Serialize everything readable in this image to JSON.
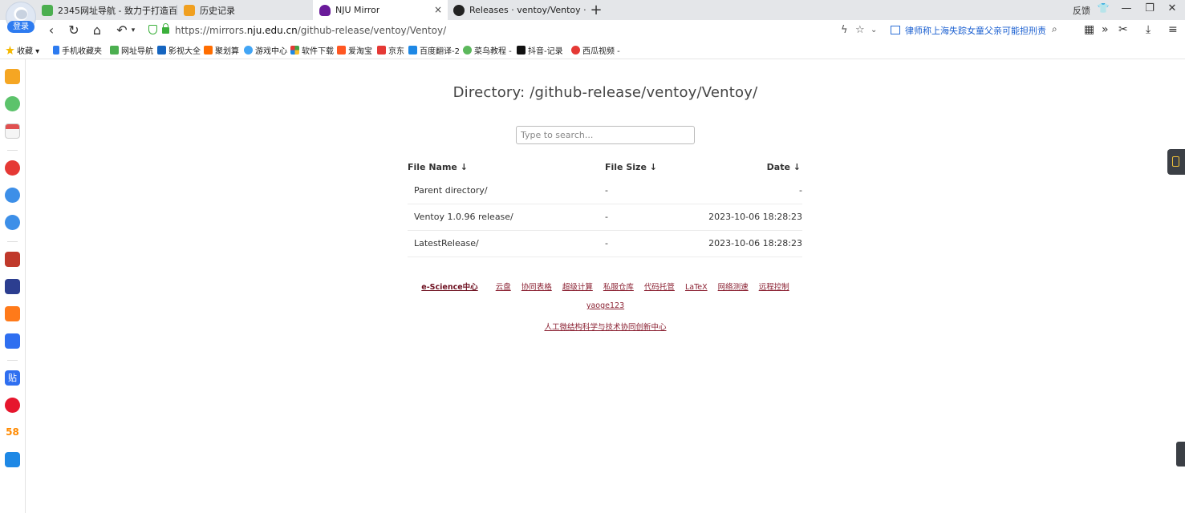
{
  "browser": {
    "login_label": "登录",
    "tabs": [
      {
        "title": "2345网址导航 - 致力于打造百",
        "color": "#4caf50"
      },
      {
        "title": "历史记录",
        "color": "#f0a020"
      },
      {
        "title": "NJU Mirror",
        "color": "#6a1b9a",
        "close": "×"
      },
      {
        "title": "Releases · ventoy/Ventoy · G",
        "color": "#222222"
      }
    ],
    "new_tab": "+",
    "feedback": "反馈",
    "url_prefix": "https://mirrors.",
    "url_domain": "nju.edu.cn",
    "url_path": "/github-release/ventoy/Ventoy/",
    "news_text": "律师称上海失踪女童父亲可能担刑责",
    "window_controls": {
      "minimize": "—",
      "restore": "❐",
      "close": "✕"
    }
  },
  "bookmarks": [
    {
      "label": "收藏 ▾",
      "color": "#f5b800"
    },
    {
      "label": "手机收藏夹",
      "color": "#2d7bf0"
    },
    {
      "label": "网址导航",
      "color": "#4caf50"
    },
    {
      "label": "影视大全",
      "color": "#1565c0"
    },
    {
      "label": "聚划算",
      "color": "#ff6d00"
    },
    {
      "label": "游戏中心",
      "color": "#42a5f5"
    },
    {
      "label": "软件下载",
      "color": "#43a047"
    },
    {
      "label": "爱淘宝",
      "color": "#ff5722"
    },
    {
      "label": "京东",
      "color": "#e53935"
    },
    {
      "label": "百度翻译-2",
      "color": "#1e88e5"
    },
    {
      "label": "菜鸟教程 -",
      "color": "#5cb85c"
    },
    {
      "label": "抖音-记录",
      "color": "#111111"
    },
    {
      "label": "西瓜视频 -",
      "color": "#e53935"
    }
  ],
  "sidebar_icons": [
    {
      "name": "favorites-icon",
      "color": "#f5a623"
    },
    {
      "name": "history-icon",
      "color": "#5cc36b"
    },
    {
      "name": "calendar-icon",
      "color": "#e05050"
    },
    {
      "name": "video-icon",
      "color": "#e53935"
    },
    {
      "name": "qq-icon-1",
      "color": "#3d8fe8"
    },
    {
      "name": "qq-icon-2",
      "color": "#3d8fe8"
    },
    {
      "name": "game-icon-1",
      "color": "#c0392b"
    },
    {
      "name": "game-icon-2",
      "color": "#2c3e90"
    },
    {
      "name": "mango-icon",
      "color": "#ff7a1a"
    },
    {
      "name": "baidu-icon",
      "color": "#2f6ff0"
    },
    {
      "name": "tieba-icon",
      "color": "#2f6ff0"
    },
    {
      "name": "weibo-icon",
      "color": "#e6162d"
    },
    {
      "name": "58-icon",
      "color": "#ff8a00"
    },
    {
      "name": "tv-icon",
      "color": "#1e88e5"
    }
  ],
  "page": {
    "title": "Directory: /github-release/ventoy/Ventoy/",
    "search_placeholder": "Type to search...",
    "columns": {
      "name": "File Name  ↓",
      "size": "File Size  ↓",
      "date": "Date  ↓"
    },
    "rows": [
      {
        "name": "Parent directory/",
        "size": "-",
        "date": "-"
      },
      {
        "name": "Ventoy 1.0.96 release/",
        "size": "-",
        "date": "2023-10-06 18:28:23"
      },
      {
        "name": "LatestRelease/",
        "size": "-",
        "date": "2023-10-06 18:28:23"
      }
    ],
    "footer_links": [
      "e-Science中心",
      "云盘",
      "协同表格",
      "超级计算",
      "私服仓库",
      "代码托管",
      "LaTeX",
      "网络测速",
      "远程控制"
    ],
    "footer_line2": "yaoge123",
    "footer_line3": "人工微结构科学与技术协同创新中心"
  }
}
